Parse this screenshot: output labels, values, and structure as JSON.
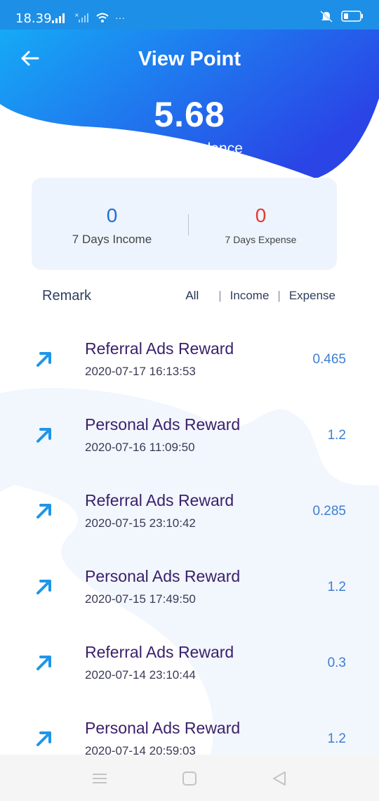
{
  "status_bar": {
    "time": "18.39",
    "more": "···"
  },
  "header": {
    "title": "View Point",
    "back_icon": "arrow-left-icon"
  },
  "balance": {
    "value": "5.68",
    "label": "Current Balance"
  },
  "summary": {
    "income_value": "0",
    "income_label": "7 Days Income",
    "expense_value": "0",
    "expense_label": "7 Days Expense"
  },
  "list_header": {
    "remark": "Remark",
    "filters": [
      "All",
      "Income",
      "Expense"
    ]
  },
  "transactions": [
    {
      "title": "Referral Ads Reward",
      "date": "2020-07-17 16:13:53",
      "amount": "0.465"
    },
    {
      "title": "Personal Ads Reward",
      "date": "2020-07-16 11:09:50",
      "amount": "1.2"
    },
    {
      "title": "Referral Ads Reward",
      "date": "2020-07-15 23:10:42",
      "amount": "0.285"
    },
    {
      "title": "Personal Ads Reward",
      "date": "2020-07-15 17:49:50",
      "amount": "1.2"
    },
    {
      "title": "Referral Ads Reward",
      "date": "2020-07-14 23:10:44",
      "amount": "0.3"
    },
    {
      "title": "Personal Ads Reward",
      "date": "2020-07-14 20:59:03",
      "amount": "1.2"
    }
  ],
  "colors": {
    "gradient_start": "#14b2f7",
    "gradient_end": "#2a44e6",
    "income": "#1f6fd1",
    "expense": "#e53935",
    "title_text": "#3a1f6b",
    "amount": "#3d7fd1",
    "arrow": "#1e96e8"
  },
  "nav_bar": {
    "icons": [
      "menu-icon",
      "home-square-icon",
      "back-triangle-icon"
    ]
  }
}
